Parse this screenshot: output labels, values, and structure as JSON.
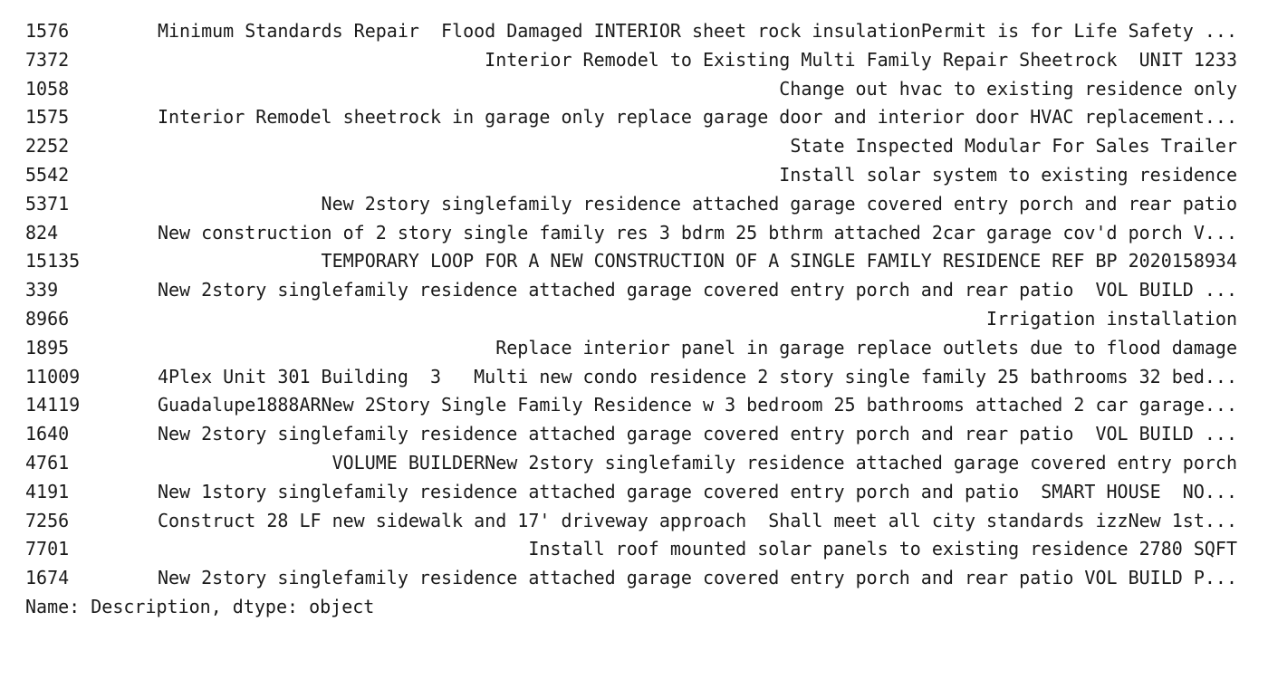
{
  "series_output": {
    "rows": [
      {
        "index": "1576",
        "description": "Minimum Standards Repair  Flood Damaged INTERIOR sheet rock insulationPermit is for Life Safety ..."
      },
      {
        "index": "7372",
        "description": "Interior Remodel to Existing Multi Family Repair Sheetrock  UNIT 1233"
      },
      {
        "index": "1058",
        "description": "Change out hvac to existing residence only"
      },
      {
        "index": "1575",
        "description": "Interior Remodel sheetrock in garage only replace garage door and interior door HVAC replacement..."
      },
      {
        "index": "2252",
        "description": "State Inspected Modular For Sales Trailer"
      },
      {
        "index": "5542",
        "description": "Install solar system to existing residence"
      },
      {
        "index": "5371",
        "description": "New 2story singlefamily residence attached garage covered entry porch and rear patio"
      },
      {
        "index": "824",
        "description": "New construction of 2 story single family res 3 bdrm 25 bthrm attached 2car garage cov'd porch V..."
      },
      {
        "index": "15135",
        "description": "TEMPORARY LOOP FOR A NEW CONSTRUCTION OF A SINGLE FAMILY RESIDENCE REF BP 2020158934"
      },
      {
        "index": "339",
        "description": "New 2story singlefamily residence attached garage covered entry porch and rear patio  VOL BUILD ..."
      },
      {
        "index": "8966",
        "description": "Irrigation installation"
      },
      {
        "index": "1895",
        "description": "Replace interior panel in garage replace outlets due to flood damage"
      },
      {
        "index": "11009",
        "description": "4Plex Unit 301 Building  3   Multi new condo residence 2 story single family 25 bathrooms 32 bed..."
      },
      {
        "index": "14119",
        "description": "Guadalupe1888ARNew 2Story Single Family Residence w 3 bedroom 25 bathrooms attached 2 car garage..."
      },
      {
        "index": "1640",
        "description": "New 2story singlefamily residence attached garage covered entry porch and rear patio  VOL BUILD ..."
      },
      {
        "index": "4761",
        "description": "VOLUME BUILDERNew 2story singlefamily residence attached garage covered entry porch"
      },
      {
        "index": "4191",
        "description": "New 1story singlefamily residence attached garage covered entry porch and patio  SMART HOUSE  NO..."
      },
      {
        "index": "7256",
        "description": "Construct 28 LF new sidewalk and 17' driveway approach  Shall meet all city standards izzNew 1st..."
      },
      {
        "index": "7701",
        "description": "Install roof mounted solar panels to existing residence 2780 SQFT"
      },
      {
        "index": "1674",
        "description": "New 2story singlefamily residence attached garage covered entry porch and rear patio VOL BUILD P..."
      }
    ],
    "footer": "Name: Description, dtype: object"
  }
}
